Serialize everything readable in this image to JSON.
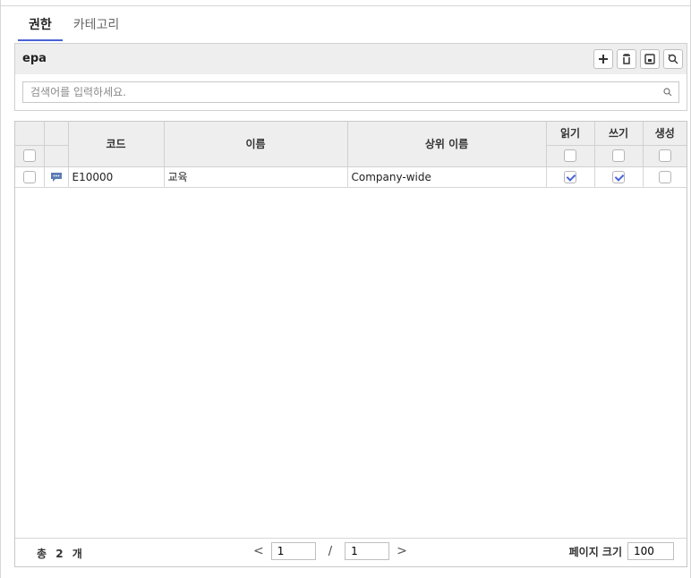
{
  "tabs": [
    {
      "label": "권한",
      "active": true
    },
    {
      "label": "카테고리",
      "active": false
    }
  ],
  "panel": {
    "title": "epa",
    "search_placeholder": "검색어를 입력하세요.",
    "buttons": [
      "add-icon",
      "delete-icon",
      "save-icon",
      "reset-search-icon"
    ]
  },
  "table": {
    "headers": {
      "code": "코드",
      "name": "이름",
      "parent_name": "상위 이름",
      "read": "읽기",
      "write": "쓰기",
      "create": "생성"
    },
    "rows": [
      {
        "code": "E10000",
        "name": "교육",
        "parent_name": "Company-wide",
        "read": true,
        "write": true,
        "create": false
      }
    ]
  },
  "pager": {
    "total_label": "총",
    "total_count": "2",
    "total_unit": "개",
    "current_page": "1",
    "total_pages": "1",
    "prev": "<",
    "next": ">",
    "separator": "/",
    "page_size_label": "페이지 크기",
    "page_size": "100"
  },
  "colors": {
    "accent": "#4a63d6",
    "header_bg": "#eeeeee",
    "border": "#d0d0d0"
  }
}
